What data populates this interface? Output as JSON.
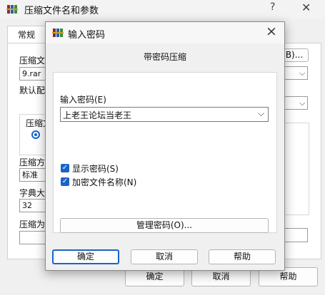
{
  "back_window": {
    "title": "压缩文件名和参数",
    "help_icon": "?",
    "tab_general": "常规",
    "archive_name_label": "压缩文",
    "archive_name_value": "9.rar",
    "browse_button": "B)...",
    "default_profile_label": "默认配",
    "format_label": "压缩文",
    "method_label": "压缩方",
    "method_value": "标准",
    "dict_label": "字典大",
    "dict_value": "32",
    "split_label": "压缩为",
    "ok_button": "确定",
    "cancel_button": "取消",
    "help_button": "帮助"
  },
  "modal": {
    "title": "输入密码",
    "heading": "带密码压缩",
    "password_label": "输入密码(E)",
    "password_value": "上老王论坛当老王",
    "show_password_label": "显示密码(S)",
    "show_password_checked": true,
    "encrypt_filenames_label": "加密文件名称(N)",
    "encrypt_filenames_checked": true,
    "manage_passwords_button": "管理密码(O)...",
    "ok_button": "确定",
    "cancel_button": "取消",
    "help_button": "帮助"
  },
  "colors": {
    "accent": "#1a64c8",
    "window_bg": "#f0f0f0",
    "panel_bg": "#ffffff"
  },
  "icons": {
    "app_icon": "winrar-books-icon",
    "close": "close-icon",
    "dropdown": "chevron-down-icon",
    "checkbox": "checkmark-icon"
  }
}
